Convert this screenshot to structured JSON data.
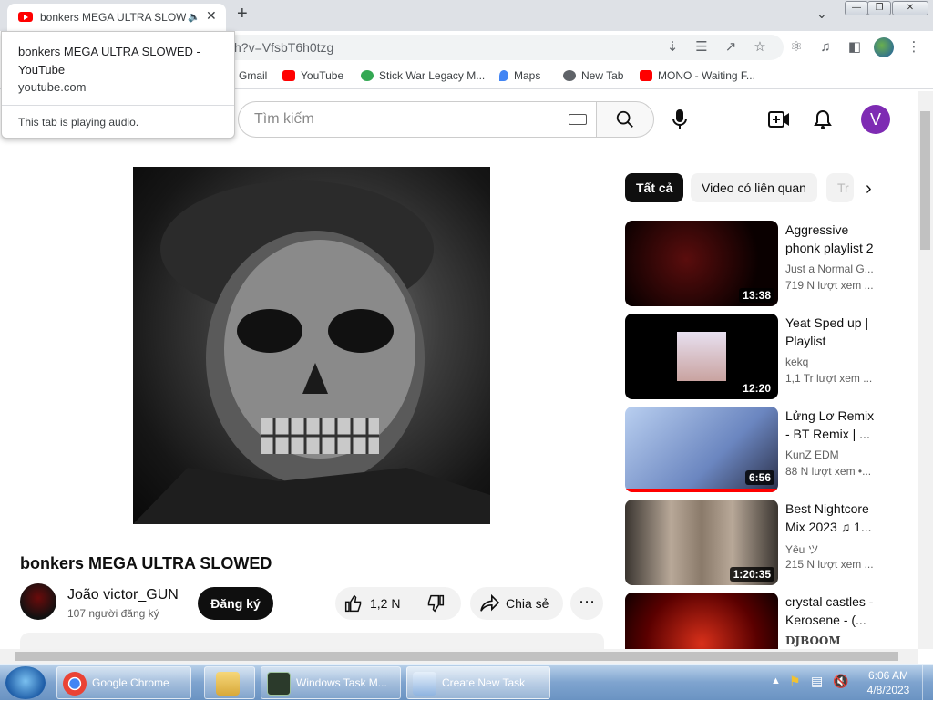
{
  "browser": {
    "tab_title": "bonkers MEGA ULTRA SLOWED - YouTube",
    "tab_title_short": "bonkers MEGA ULTRA SLOW",
    "url_visible": "h?v=VfsbT6h0tzg",
    "tooltip": {
      "title": "bonkers MEGA ULTRA SLOWED - YouTube",
      "domain": "youtube.com",
      "status": "This tab is playing audio."
    },
    "bookmarks": [
      {
        "label": "Gmail",
        "color": "#ffffff"
      },
      {
        "label": "YouTube",
        "color": "#ff0000"
      },
      {
        "label": "Stick War Legacy M...",
        "color": "#34a853"
      },
      {
        "label": "Maps",
        "color": "#4285f4"
      },
      {
        "label": "New Tab",
        "color": "#5f6368"
      },
      {
        "label": "MONO - Waiting F...",
        "color": "#ff0000"
      }
    ]
  },
  "youtube": {
    "search_placeholder": "Tìm kiếm",
    "avatar_letter": "V",
    "video": {
      "title": "bonkers MEGA ULTRA SLOWED",
      "channel": "João victor_GUN",
      "subscribers": "107 người đăng ký",
      "subscribe_label": "Đăng ký",
      "likes": "1,2 N",
      "share_label": "Chia sẻ"
    },
    "chips": [
      "Tất cả",
      "Video có liên quan",
      "Tr"
    ],
    "related": [
      {
        "title": "Aggressive phonk playlist 2",
        "channel": "Just a Normal G...",
        "views": "719 N lượt xem ...",
        "duration": "13:38"
      },
      {
        "title": "Yeat Sped up | Playlist",
        "channel": "kekq",
        "views": "1,1 Tr lượt xem ...",
        "duration": "12:20"
      },
      {
        "title": "Lửng Lơ Remix - BT Remix | ...",
        "channel": "KunZ EDM",
        "views": "88 N lượt xem  •...",
        "duration": "6:56"
      },
      {
        "title": "Best Nightcore Mix 2023 ♫ 1...",
        "channel": "Yêu ツ",
        "views": "215 N lượt xem ...",
        "duration": "1:20:35"
      },
      {
        "title": "crystal castles - Kerosene - (...",
        "channel": "DJBOOM",
        "views": "",
        "duration": ""
      }
    ]
  },
  "taskbar": {
    "items": [
      "Google Chrome",
      "Windows Task M...",
      "Create New Task"
    ],
    "time": "6:06 AM",
    "date": "4/8/2023"
  }
}
